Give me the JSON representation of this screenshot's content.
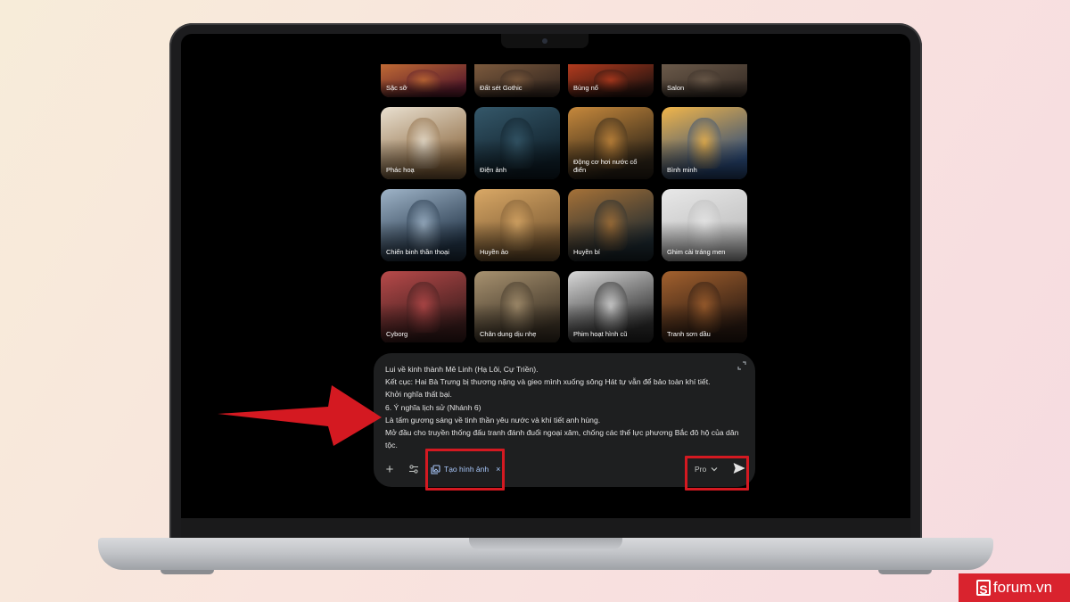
{
  "gallery": {
    "styles": [
      {
        "label": "Sặc sỡ",
        "c1": "#5a1c2b",
        "c2": "#c06a34"
      },
      {
        "label": "Đất sét Gothic",
        "c1": "#3a2b22",
        "c2": "#7c5a3d"
      },
      {
        "label": "Bùng nổ",
        "c1": "#2c1510",
        "c2": "#b33b1e"
      },
      {
        "label": "Salon",
        "c1": "#3b3028",
        "c2": "#6b5a4a"
      },
      {
        "label": "Phác hoạ",
        "c1": "#8d6a42",
        "c2": "#e9e0d0"
      },
      {
        "label": "Điện ảnh",
        "c1": "#0f1f29",
        "c2": "#35586a"
      },
      {
        "label": "Động cơ hơi nước cổ điển",
        "c1": "#2d2418",
        "c2": "#c7893c"
      },
      {
        "label": "Bình minh",
        "c1": "#2a4a7a",
        "c2": "#f2b64a"
      },
      {
        "label": "Chiến binh thần thoại",
        "c1": "#223447",
        "c2": "#9fb4c8"
      },
      {
        "label": "Huyền ảo",
        "c1": "#7b5a33",
        "c2": "#d9a866"
      },
      {
        "label": "Huyền bí",
        "c1": "#1d2930",
        "c2": "#a67238"
      },
      {
        "label": "Ghim cài tráng men",
        "c1": "#bdbdbd",
        "c2": "#e8e8e8"
      },
      {
        "label": "Cyborg",
        "c1": "#3a1c1c",
        "c2": "#b84a4a"
      },
      {
        "label": "Chân dung dịu nhẹ",
        "c1": "#3d3326",
        "c2": "#a89270"
      },
      {
        "label": "Phim hoạt hình cũ",
        "c1": "#2a2a2a",
        "c2": "#dadada"
      },
      {
        "label": "Tranh sơn dầu",
        "c1": "#2a1a12",
        "c2": "#a3612e"
      }
    ]
  },
  "prompt": {
    "lines": [
      "Lui về kinh thành Mê Linh (Hạ Lôi, Cự Triền).",
      "Kết cục: Hai Bà Trưng bị thương nặng và gieo mình xuống sông Hát tự vẫn để bảo toàn khí tiết.",
      "Khởi nghĩa thất bại.",
      "6. Ý nghĩa lịch sử (Nhánh 6)",
      "Là tấm gương sáng về tinh thần yêu nước và khí tiết anh hùng.",
      "Mở đầu cho truyền thống đấu tranh đánh đuổi ngoại xâm, chống các thế lực phương Bắc đô hộ của dân tộc."
    ],
    "plus_label": "+",
    "tool_chip": "Tạo hình ảnh",
    "tool_chip_close": "×",
    "model": "Pro"
  },
  "watermark": {
    "letter": "S",
    "text": "forum.vn"
  },
  "colors": {
    "highlight": "#d41921",
    "accent": "#a8c7fa"
  }
}
